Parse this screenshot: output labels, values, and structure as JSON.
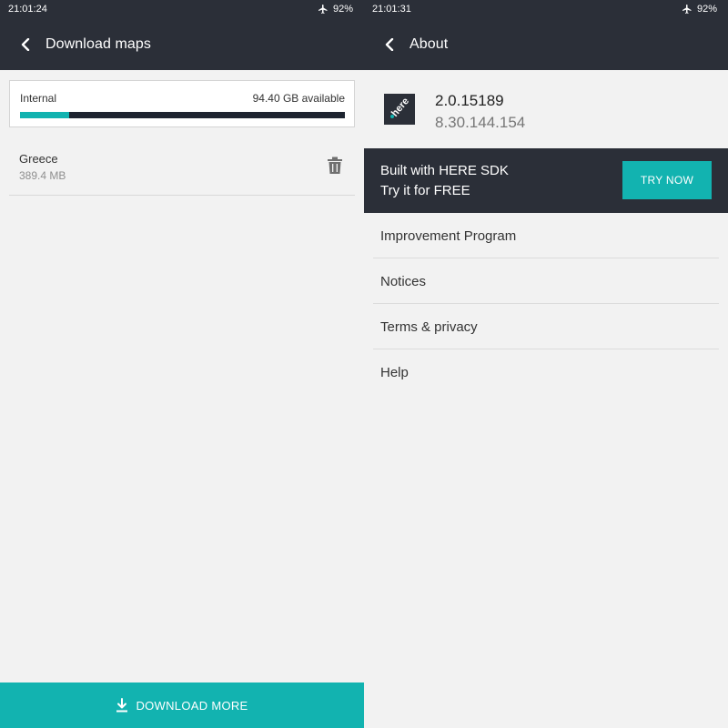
{
  "left": {
    "status": {
      "time": "21:01:24",
      "battery": "92%"
    },
    "appbar": {
      "title": "Download maps"
    },
    "storage": {
      "label": "Internal",
      "available": "94.40 GB available",
      "used_fraction": 0.15
    },
    "maps": [
      {
        "name": "Greece",
        "size": "389.4 MB"
      }
    ],
    "download_button": {
      "label": "DOWNLOAD MORE"
    }
  },
  "right": {
    "status": {
      "time": "21:01:31",
      "battery": "92%"
    },
    "appbar": {
      "title": "About"
    },
    "logo_text": "here",
    "version": {
      "main": "2.0.15189",
      "sub": "8.30.144.154"
    },
    "sdk_banner": {
      "line1": "Built with HERE SDK",
      "line2": "Try it for FREE",
      "button": "TRY NOW"
    },
    "menu": [
      {
        "label": "Improvement Program"
      },
      {
        "label": "Notices"
      },
      {
        "label": "Terms & privacy"
      },
      {
        "label": "Help"
      }
    ]
  },
  "colors": {
    "dark": "#2b2f38",
    "accent": "#12b3b0",
    "background": "#f2f2f2"
  }
}
